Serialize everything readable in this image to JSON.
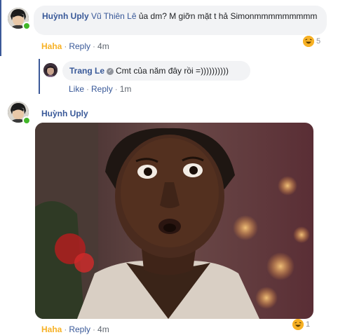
{
  "comment1": {
    "author": "Huỳnh Uply",
    "mention": "Vũ Thiên Lê",
    "text": " ủa dm? M giỡn mặt t hả Simonmmmmmmmmm",
    "reacted": "Haha",
    "reply": "Reply",
    "time": "4m",
    "reaction_count": "5"
  },
  "reply1": {
    "author": "Trang Le",
    "text": "Cmt của năm đây rồi =))))))))))",
    "like": "Like",
    "reply": "Reply",
    "time": "1m"
  },
  "comment2": {
    "author": "Huỳnh Uply",
    "reacted": "Haha",
    "reply": "Reply",
    "time": "4m",
    "reaction_count": "1"
  },
  "colors": {
    "link": "#385898",
    "haha": "#f7b125",
    "bubble": "#f2f3f5",
    "online": "#42b72a"
  },
  "icons": [
    "avatar-huynh",
    "avatar-trang",
    "online-dot",
    "verified-icon",
    "haha-emoji-icon"
  ]
}
